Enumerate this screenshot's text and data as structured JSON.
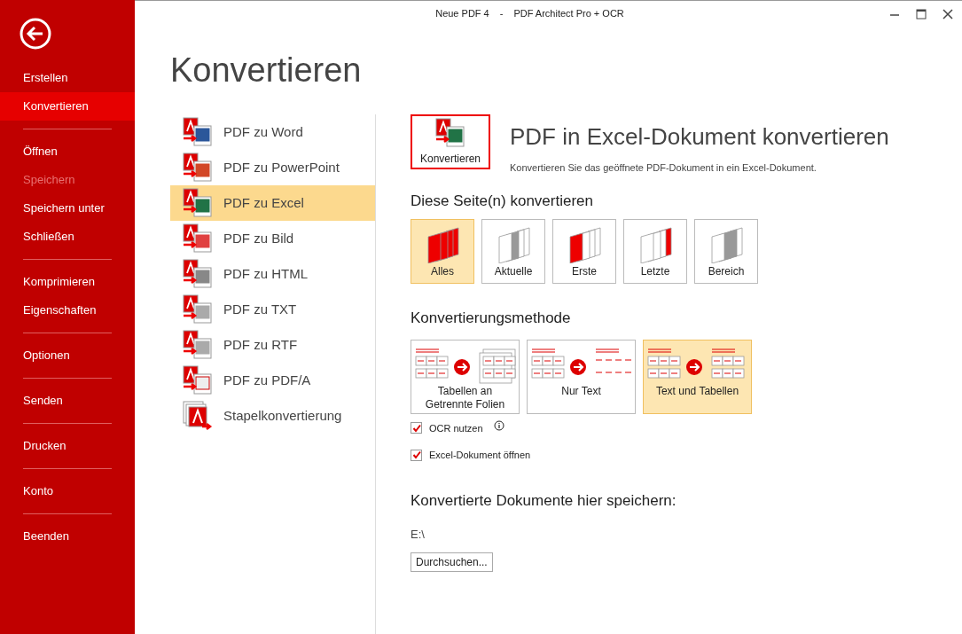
{
  "window": {
    "title_document": "Neue PDF 4",
    "title_separator": "-",
    "title_app": "PDF Architect Pro + OCR"
  },
  "sidebar": {
    "groups": [
      [
        {
          "label": "Erstellen",
          "selected": false,
          "disabled": false
        },
        {
          "label": "Konvertieren",
          "selected": true,
          "disabled": false
        }
      ],
      [
        {
          "label": "Öffnen",
          "selected": false,
          "disabled": false
        },
        {
          "label": "Speichern",
          "selected": false,
          "disabled": true
        },
        {
          "label": "Speichern unter",
          "selected": false,
          "disabled": false
        },
        {
          "label": "Schließen",
          "selected": false,
          "disabled": false
        }
      ],
      [
        {
          "label": "Komprimieren",
          "selected": false,
          "disabled": false
        },
        {
          "label": "Eigenschaften",
          "selected": false,
          "disabled": false
        }
      ],
      [
        {
          "label": "Optionen",
          "selected": false,
          "disabled": false
        }
      ],
      [
        {
          "label": "Senden",
          "selected": false,
          "disabled": false
        }
      ],
      [
        {
          "label": "Drucken",
          "selected": false,
          "disabled": false
        }
      ],
      [
        {
          "label": "Konto",
          "selected": false,
          "disabled": false
        }
      ],
      [
        {
          "label": "Beenden",
          "selected": false,
          "disabled": false
        }
      ]
    ]
  },
  "page_title": "Konvertieren",
  "conversions": [
    {
      "label": "PDF zu Word",
      "kind": "word",
      "selected": false
    },
    {
      "label": "PDF zu PowerPoint",
      "kind": "powerpoint",
      "selected": false
    },
    {
      "label": "PDF zu Excel",
      "kind": "excel",
      "selected": true
    },
    {
      "label": "PDF zu Bild",
      "kind": "image",
      "selected": false
    },
    {
      "label": "PDF zu HTML",
      "kind": "html",
      "selected": false
    },
    {
      "label": "PDF zu TXT",
      "kind": "txt",
      "selected": false
    },
    {
      "label": "PDF zu RTF",
      "kind": "rtf",
      "selected": false
    },
    {
      "label": "PDF zu PDF/A",
      "kind": "pdfa",
      "selected": false
    },
    {
      "label": "Stapelkonvertierung",
      "kind": "batch",
      "selected": false
    }
  ],
  "convert_button": {
    "label": "Konvertieren"
  },
  "detail": {
    "heading": "PDF in Excel-Dokument konvertieren",
    "description": "Konvertieren Sie das geöffnete PDF-Dokument in ein Excel-Dokument."
  },
  "pages_section": {
    "heading": "Diese Seite(n) konvertieren",
    "options": [
      {
        "label": "Alles",
        "kind": "all",
        "selected": true
      },
      {
        "label": "Aktuelle",
        "kind": "current",
        "selected": false
      },
      {
        "label": "Erste",
        "kind": "first",
        "selected": false
      },
      {
        "label": "Letzte",
        "kind": "last",
        "selected": false
      },
      {
        "label": "Bereich",
        "kind": "range",
        "selected": false
      }
    ]
  },
  "method_section": {
    "heading": "Konvertierungsmethode",
    "options": [
      {
        "label": "Tabellen an Getrennte Folien",
        "kind": "sheets",
        "selected": false
      },
      {
        "label": "Nur Text",
        "kind": "text",
        "selected": false
      },
      {
        "label": "Text und Tabellen",
        "kind": "both",
        "selected": true
      }
    ]
  },
  "checkboxes": [
    {
      "label": "OCR nutzen",
      "checked": true,
      "info": true
    },
    {
      "label": "Excel-Dokument öffnen",
      "checked": true,
      "info": false
    }
  ],
  "save_section": {
    "heading": "Konvertierte Dokumente hier speichern:",
    "path": "E:\\",
    "browse_button": "Durchsuchen..."
  }
}
